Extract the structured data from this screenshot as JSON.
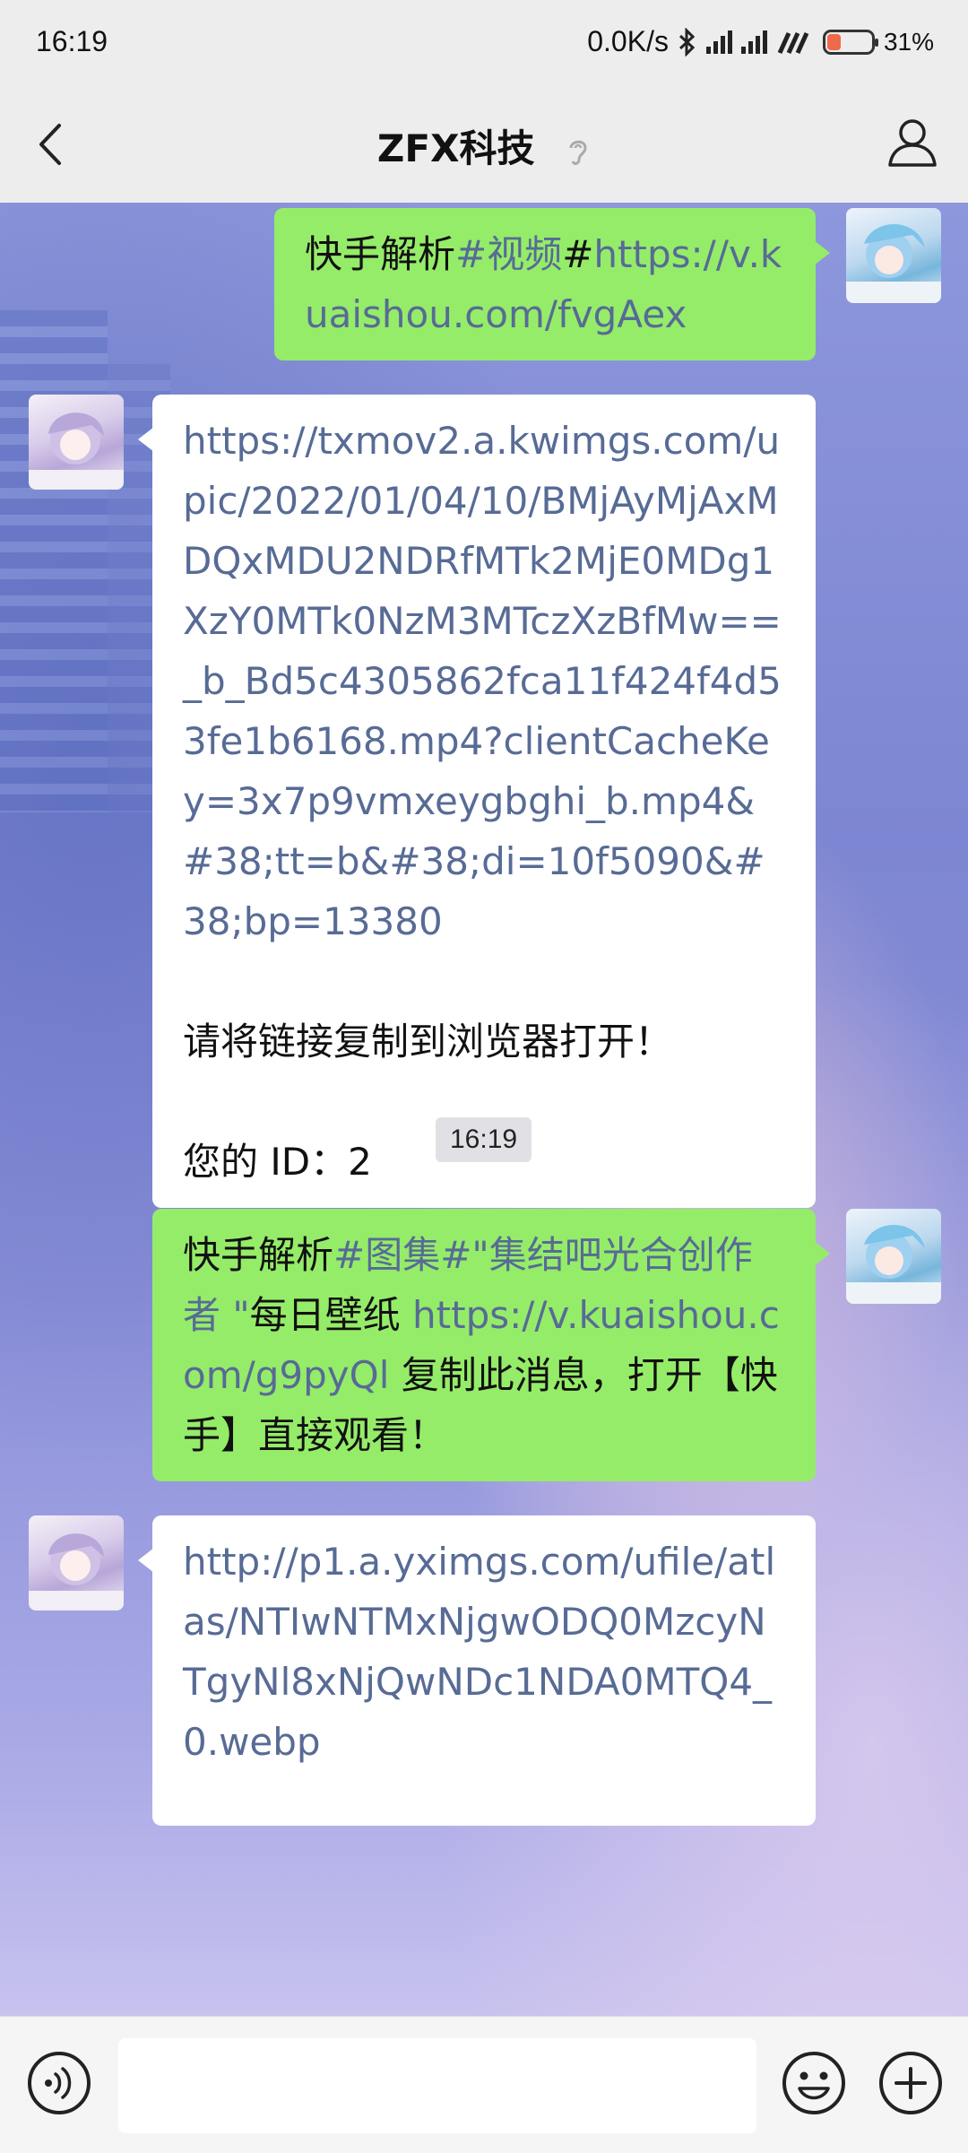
{
  "status_bar": {
    "time": "16:19",
    "network_speed": "0.0K/s",
    "battery_percent": "31%",
    "battery_level": 0.31,
    "icons": [
      "bluetooth-icon",
      "signal-icon",
      "signal-icon",
      "wifi-icon",
      "battery-icon"
    ]
  },
  "header": {
    "title": "ZFX科技",
    "back_icon": "chevron-left-icon",
    "ear_icon": "ear-icon",
    "profile_icon": "person-icon"
  },
  "messages": [
    {
      "direction": "outgoing",
      "parts": [
        {
          "text": "快手解析",
          "style": "plain"
        },
        {
          "text": "#视频",
          "style": "link"
        },
        {
          "text": "#",
          "style": "plain"
        },
        {
          "text": "https://v.kuaishou.com/fvgAex",
          "style": "link"
        }
      ]
    },
    {
      "direction": "incoming",
      "url": "https://txmov2.a.kwimgs.com/upic/2022/01/04/10/BMjAyMjAxMDQxMDU2NDRfMTk2MjE0MDg1XzY0MTk0NzM3MTczXzBfMw==_b_Bd5c4305862fca11f424f4d53fe1b6168.mp4?clientCacheKey=3x7p9vmxeygbghi_b.mp4&#38;tt=b&#38;di=10f5090&#38;bp=13380",
      "line2": "请将链接复制到浏览器打开！",
      "line3": "您的 ID：2"
    },
    {
      "direction": "outgoing",
      "parts": [
        {
          "text": "快手解析",
          "style": "plain"
        },
        {
          "text": "#图集#\"集结吧光合创作者 \"",
          "style": "link"
        },
        {
          "text": "每日壁纸 ",
          "style": "plain"
        },
        {
          "text": "https://v.kuaishou.com/g9pyQl",
          "style": "link"
        },
        {
          "text": " 复制此消息，打开【快手】直接观看！",
          "style": "plain"
        }
      ]
    },
    {
      "direction": "incoming",
      "url": "http://p1.a.yximgs.com/ufile/atlas/NTIwNTMxNjgwODQ0MzcyNTgyNl8xNjQwNDc1NDA0MTQ4_0.webp"
    }
  ],
  "timestamp": "16:19",
  "input_bar": {
    "text_value": "",
    "voice_icon": "voice-icon",
    "emoji_icon": "emoji-icon",
    "plus_icon": "plus-icon"
  }
}
